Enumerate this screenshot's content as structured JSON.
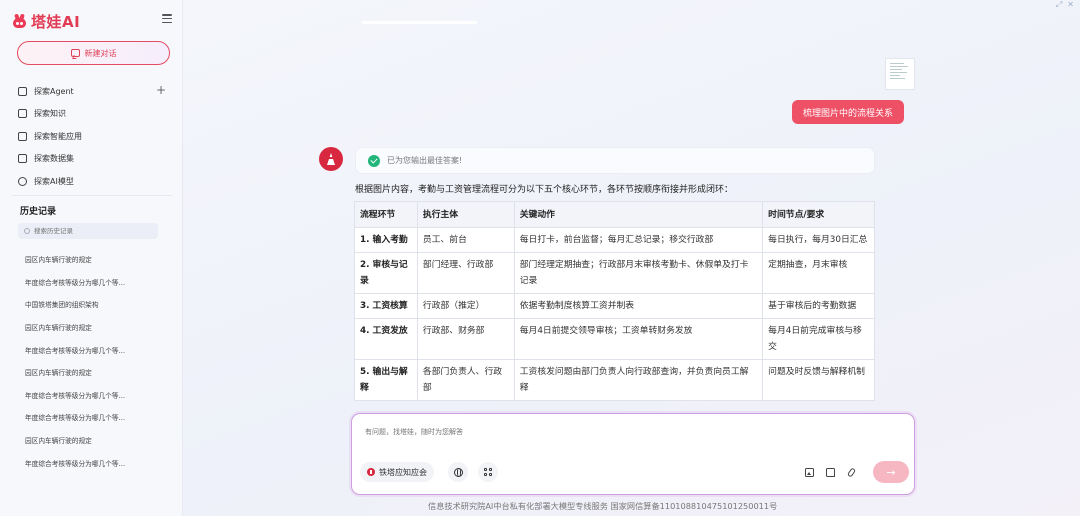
{
  "app": {
    "name": "塔娃AI"
  },
  "sidebar": {
    "new_chat_label": "新建对话",
    "nav": [
      {
        "label": "探索Agent",
        "icon": "home-icon"
      },
      {
        "label": "探索知识",
        "icon": "book-icon"
      },
      {
        "label": "探索智能应用",
        "icon": "robot-icon"
      },
      {
        "label": "探索数据集",
        "icon": "database-icon"
      },
      {
        "label": "探索AI模型",
        "icon": "cube-icon"
      }
    ],
    "history_title": "历史记录",
    "history_search_placeholder": "搜索历史记录",
    "history": [
      "园区内车辆行驶的规定",
      "年度综合考核等级分为哪几个等...",
      "中国铁塔集团的组织架构",
      "园区内车辆行驶的规定",
      "年度综合考核等级分为哪几个等...",
      "园区内车辆行驶的规定",
      "年度综合考核等级分为哪几个等...",
      "年度综合考核等级分为哪几个等...",
      "园区内车辆行驶的规定",
      "年度综合考核等级分为哪几个等..."
    ]
  },
  "conversation": {
    "user_message": "梳理图片中的流程关系",
    "status_text": "已为您输出最佳答案!",
    "answer_intro": "根据图片内容，考勤与工资管理流程可分为以下五个核心环节，各环节按顺序衔接并形成闭环：",
    "table": {
      "headers": [
        "流程环节",
        "执行主体",
        "关键动作",
        "时间节点/要求"
      ],
      "rows": [
        [
          "1. 输入考勤",
          "员工、前台",
          "每日打卡，前台监督；每月汇总记录；移交行政部",
          "每日执行，每月30日汇总"
        ],
        [
          "2. 审核与记录",
          "部门经理、行政部",
          "部门经理定期抽查；行政部月末审核考勤卡、休假单及打卡记录",
          "定期抽查，月末审核"
        ],
        [
          "3. 工资核算",
          "行政部（推定）",
          "依据考勤制度核算工资并制表",
          "基于审核后的考勤数据"
        ],
        [
          "4. 工资发放",
          "行政部、财务部",
          "每月4日前提交领导审核；工资单转财务发放",
          "每月4日前完成审核与移交"
        ],
        [
          "5. 输出与解释",
          "各部门负责人、行政部",
          "工资核发问题由部门负责人向行政部查询，并负责向员工解释",
          "问题及时反馈与解释机制"
        ]
      ]
    }
  },
  "input": {
    "placeholder": "有问题，找塔娃，随时为您解答",
    "chip_label": "铁塔应知应会"
  },
  "footer": "信息技术研究院AI中台私有化部署大模型专线服务 国家网信算备110108810475101250011号",
  "colors": {
    "brand": "#e23b55",
    "user_bubble": "#ee5066",
    "success": "#22b67a",
    "send_disabled": "#f6b7c2"
  }
}
